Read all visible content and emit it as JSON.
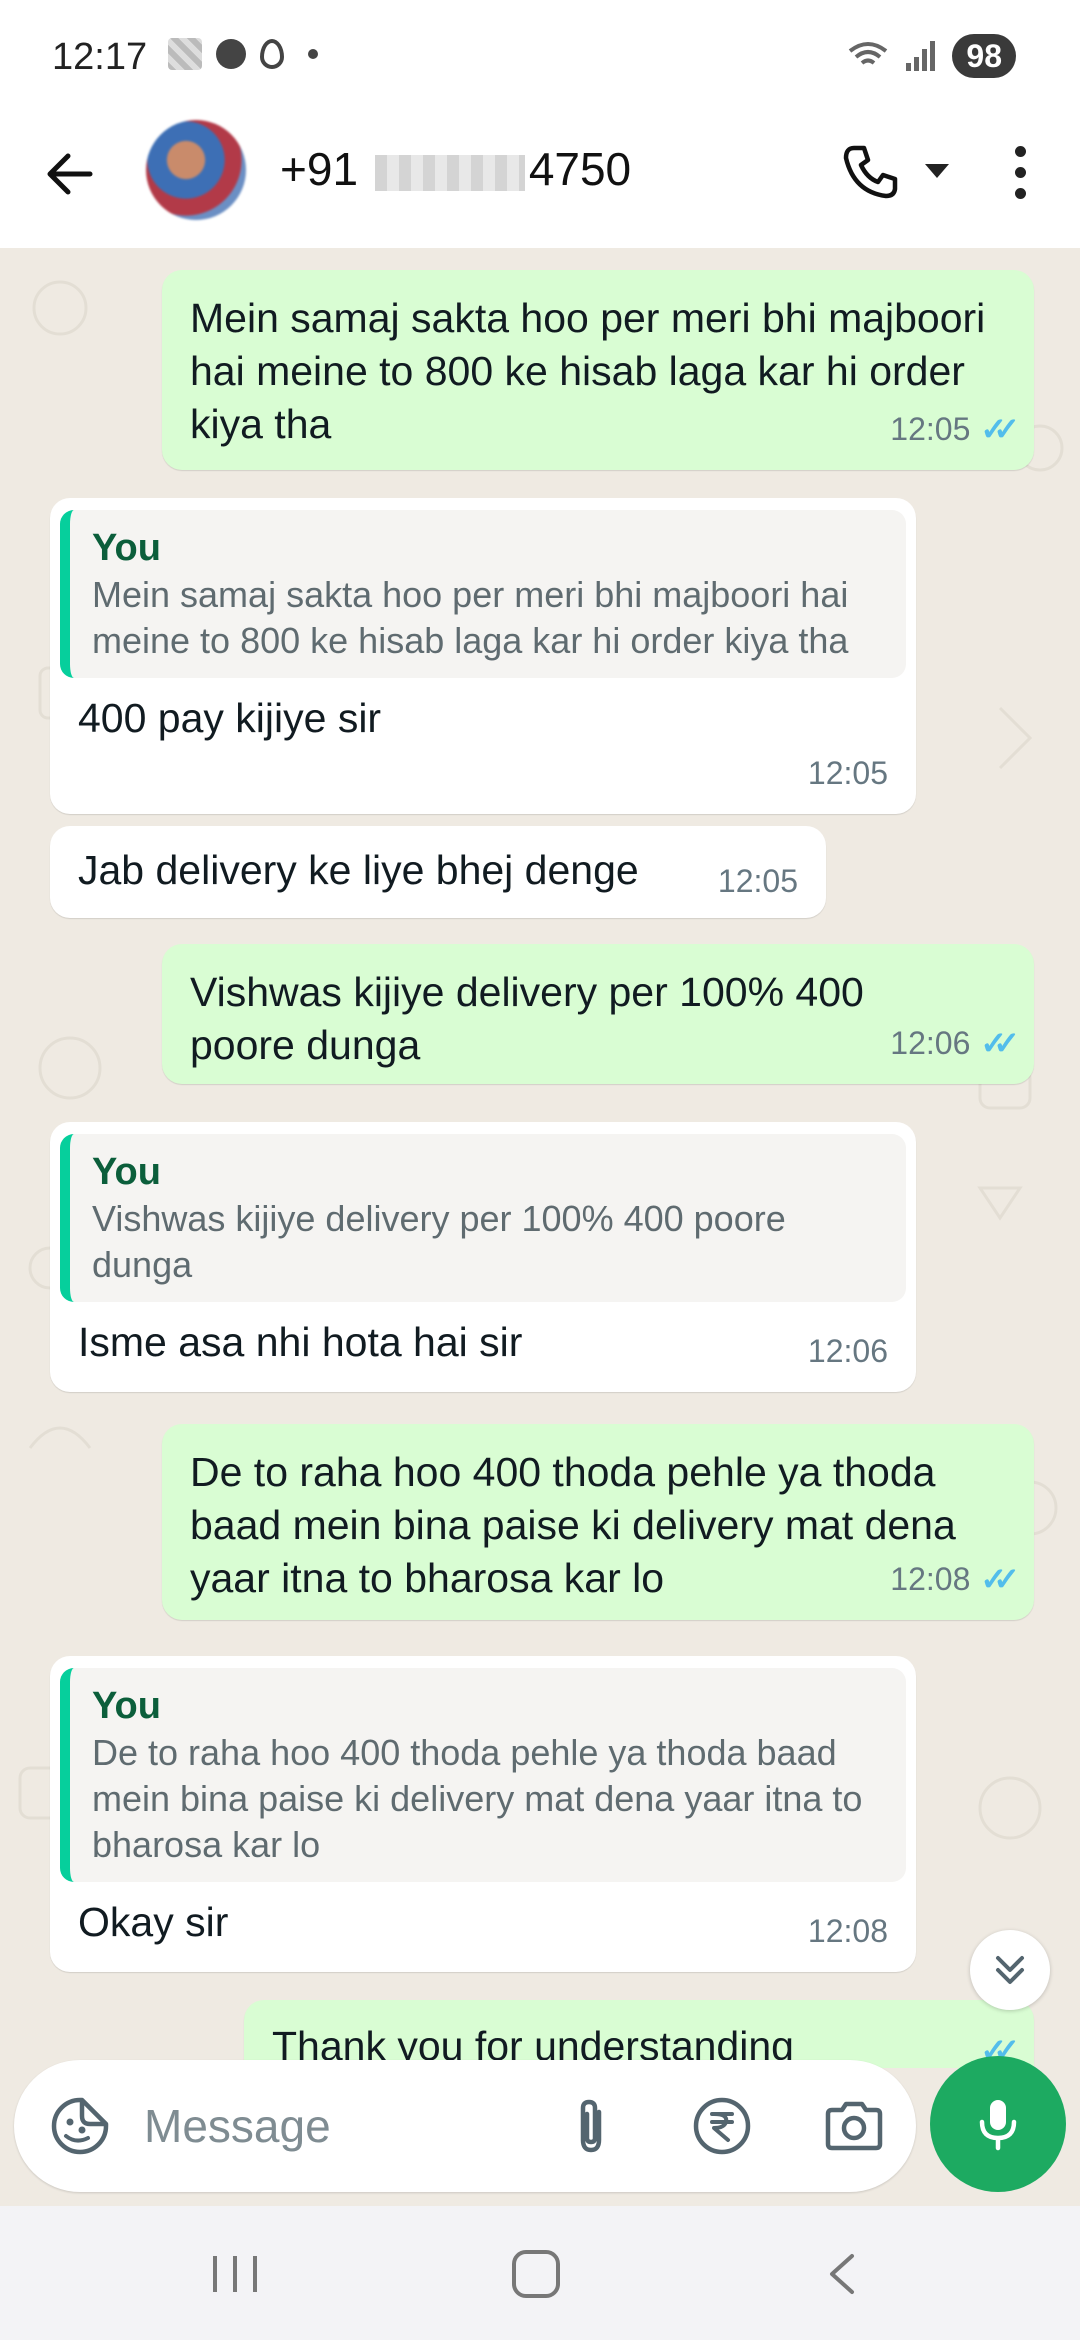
{
  "status_bar": {
    "time": "12:17",
    "battery": "98"
  },
  "header": {
    "contact_prefix": "+91",
    "contact_suffix": "4750"
  },
  "messages": [
    {
      "type": "out",
      "text": "Mein samaj sakta hoo per meri bhi majboori hai meine to 800 ke hisab laga kar hi order kiya tha",
      "time": "12:05",
      "ticks": "✓✓"
    },
    {
      "type": "in",
      "quote_author": "You",
      "quote_text": "Mein samaj sakta hoo per meri bhi majboori hai meine to 800 ke hisab laga  kar hi order kiya tha",
      "text": "400 pay kijiye sir",
      "time": "12:05"
    },
    {
      "type": "in",
      "text": "Jab delivery ke liye bhej denge",
      "time": "12:05"
    },
    {
      "type": "out",
      "text": "Vishwas kijiye delivery per 100% 400 poore dunga",
      "time": "12:06",
      "ticks": "✓✓"
    },
    {
      "type": "in",
      "quote_author": "You",
      "quote_text": "Vishwas kijiye delivery per 100% 400 poore dunga",
      "text": "Isme asa nhi hota hai sir",
      "time": "12:06"
    },
    {
      "type": "out",
      "text": "De to raha hoo 400 thoda pehle ya thoda baad mein bina paise ki delivery mat dena yaar itna to bharosa kar lo",
      "time": "12:08",
      "ticks": "✓✓"
    },
    {
      "type": "in",
      "quote_author": "You",
      "quote_text": "De to raha hoo 400 thoda pehle ya thoda baad mein bina paise ki delivery mat dena yaar itna to bharosa kar lo",
      "text": "Okay sir",
      "time": "12:08"
    },
    {
      "type": "out",
      "text": "Thank you for understanding",
      "time": "",
      "ticks": "✓✓"
    }
  ],
  "composer": {
    "placeholder": "Message"
  },
  "colors": {
    "outgoing_bubble": "#d9fdd3",
    "incoming_bubble": "#ffffff",
    "chat_background": "#efeae2",
    "accent_green": "#1daa61",
    "read_ticks": "#53bdeb",
    "quote_bar": "#06cf9c"
  },
  "icons": [
    "back-arrow-icon",
    "phone-icon",
    "more-vert-icon",
    "scroll-down-icon",
    "sticker-icon",
    "attach-icon",
    "rupee-icon",
    "camera-icon",
    "mic-icon"
  ]
}
